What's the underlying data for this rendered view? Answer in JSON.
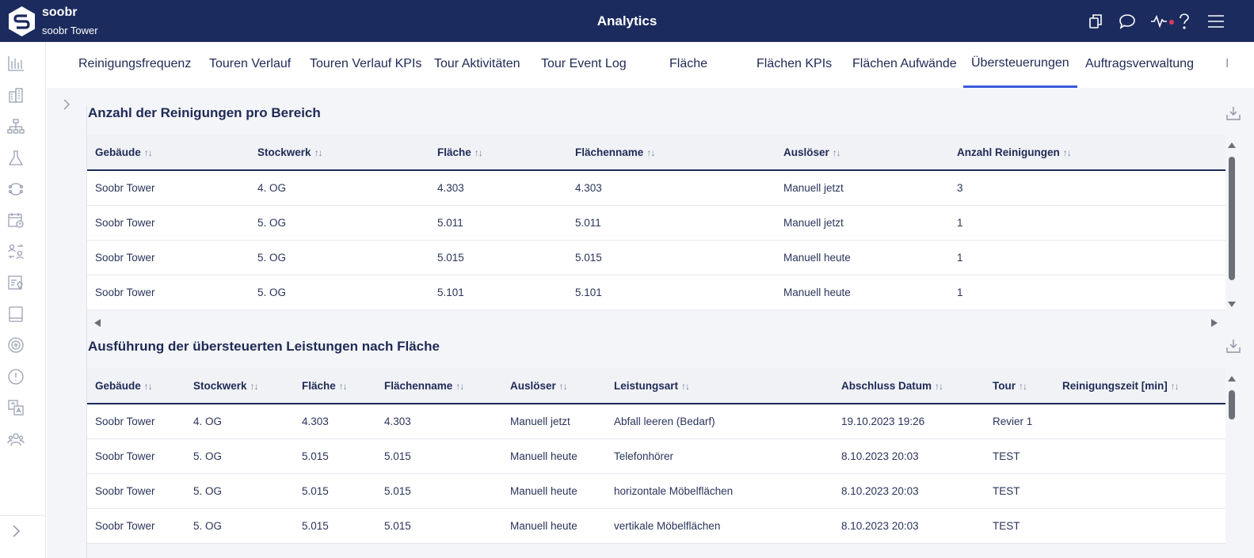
{
  "header": {
    "brand": "soobr",
    "building": "soobr Tower",
    "title": "Analytics"
  },
  "tabs": [
    "Reinigungsfrequenz",
    "Touren Verlauf",
    "Touren Verlauf KPIs",
    "Tour Aktivitäten",
    "Tour Event Log",
    "Fläche",
    "Flächen KPIs",
    "Flächen Aufwände",
    "Übersteuerungen",
    "Auftragsverwaltung",
    "I"
  ],
  "active_tab": "Übersteuerungen",
  "table1": {
    "title": "Anzahl der Reinigungen pro Bereich",
    "columns": [
      "Gebäude",
      "Stockwerk",
      "Fläche",
      "Flächenname",
      "Auslöser",
      "Anzahl Reinigungen"
    ],
    "rows": [
      [
        "Soobr Tower",
        "4. OG",
        "4.303",
        "4.303",
        "Manuell jetzt",
        "3"
      ],
      [
        "Soobr Tower",
        "5. OG",
        "5.011",
        "5.011",
        "Manuell jetzt",
        "1"
      ],
      [
        "Soobr Tower",
        "5. OG",
        "5.015",
        "5.015",
        "Manuell heute",
        "1"
      ],
      [
        "Soobr Tower",
        "5. OG",
        "5.101",
        "5.101",
        "Manuell heute",
        "1"
      ]
    ]
  },
  "table2": {
    "title": "Ausführung der übersteuerten Leistungen nach Fläche",
    "columns": [
      "Gebäude",
      "Stockwerk",
      "Fläche",
      "Flächenname",
      "Auslöser",
      "Leistungsart",
      "Abschluss Datum",
      "Tour",
      "Reinigungszeit [min]"
    ],
    "rows": [
      [
        "Soobr Tower",
        "4. OG",
        "4.303",
        "4.303",
        "Manuell jetzt",
        "Abfall leeren (Bedarf)",
        "19.10.2023 19:26",
        "Revier 1",
        ""
      ],
      [
        "Soobr Tower",
        "5. OG",
        "5.015",
        "5.015",
        "Manuell heute",
        "Telefonhörer",
        "8.10.2023 20:03",
        "TEST",
        ""
      ],
      [
        "Soobr Tower",
        "5. OG",
        "5.015",
        "5.015",
        "Manuell heute",
        "horizontale Möbelflächen",
        "8.10.2023 20:03",
        "TEST",
        ""
      ],
      [
        "Soobr Tower",
        "5. OG",
        "5.015",
        "5.015",
        "Manuell heute",
        "vertikale Möbelflächen",
        "8.10.2023 20:03",
        "TEST",
        ""
      ]
    ]
  },
  "icons": {
    "rail": [
      "bar-chart-icon",
      "building-icon",
      "hierarchy-icon",
      "flask-icon",
      "cycle-icon",
      "calendar-clock-icon",
      "user-swap-icon",
      "report-icon",
      "tablet-icon",
      "sensor-icon",
      "alert-icon",
      "translate-icon",
      "team-icon"
    ],
    "top": [
      "copy-icon",
      "chat-icon",
      "activity-icon",
      "help-icon",
      "menu-icon"
    ]
  }
}
